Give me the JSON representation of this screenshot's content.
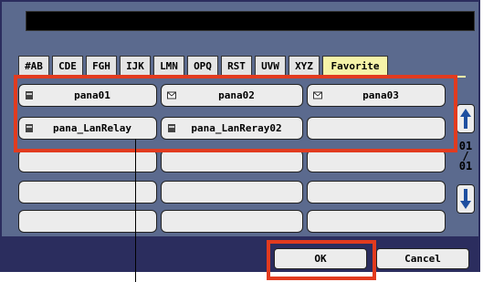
{
  "colors": {
    "panel": "#5b6a8e",
    "favorite_tab": "#f6f3a8",
    "highlight": "#e23b1f",
    "footer": "#2b2d5e"
  },
  "tabs": [
    "#AB",
    "CDE",
    "FGH",
    "IJK",
    "LMN",
    "OPQ",
    "RST",
    "UVW",
    "XYZ",
    "Favorite"
  ],
  "active_tab": "Favorite",
  "favorites": [
    {
      "label": "pana01",
      "icon": "printer-icon"
    },
    {
      "label": "pana02",
      "icon": "mail-icon"
    },
    {
      "label": "pana03",
      "icon": "mail-icon"
    },
    {
      "label": "pana_LanRelay",
      "icon": "printer-icon"
    },
    {
      "label": "pana_LanReray02",
      "icon": "printer-icon"
    },
    {
      "label": "",
      "icon": ""
    }
  ],
  "page_indicator": {
    "current": "01",
    "separator": "/",
    "total": "01"
  },
  "buttons": {
    "ok": "OK",
    "cancel": "Cancel"
  }
}
